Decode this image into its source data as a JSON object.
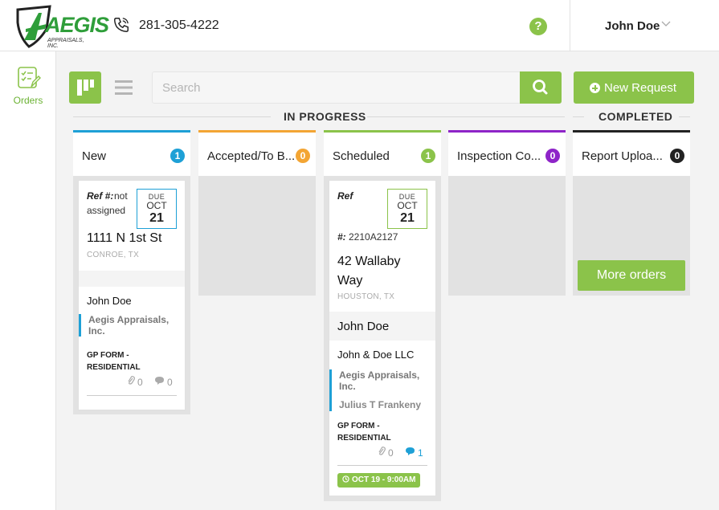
{
  "brand": {
    "name": "AEGIS",
    "sub": "APPRAISALS, INC."
  },
  "header": {
    "phone": "281-305-4222",
    "user_name": "John Doe"
  },
  "sidebar": {
    "items": [
      {
        "label": "Orders"
      }
    ]
  },
  "toolbar": {
    "search_placeholder": "Search",
    "new_request_label": "New Request"
  },
  "groups": {
    "in_progress": "IN PROGRESS",
    "completed": "COMPLETED"
  },
  "colors": {
    "accent": "#8bc34a",
    "blue": "#1ea0d6",
    "orange": "#f3a534",
    "green": "#8bc34a",
    "purple": "#8e24c8",
    "dark": "#222222"
  },
  "columns": [
    {
      "title": "New",
      "count": "1"
    },
    {
      "title": "Accepted/To B...",
      "count": "0"
    },
    {
      "title": "Scheduled",
      "count": "1"
    },
    {
      "title": "Inspection Co...",
      "count": "0"
    },
    {
      "title": "Report Uploa...",
      "count": "0"
    }
  ],
  "cards": [
    {
      "ref_label": "Ref #:",
      "ref_value_1": "not",
      "ref_value_2": "assigned",
      "due_label": "DUE",
      "due_month": "OCT",
      "due_day": "21",
      "address": "1111 N 1st St",
      "city": "CONROE, TX",
      "person": "John Doe",
      "company_1": "Aegis Appraisals,",
      "company_2": "Inc.",
      "form_1": "GP FORM -",
      "form_2": "RESIDENTIAL",
      "attachments": "0",
      "comments": "0"
    },
    {
      "ref_label_1": "Ref",
      "ref_label_2": "#:",
      "ref_value": "2210A2127",
      "due_label": "DUE",
      "due_month": "OCT",
      "due_day": "21",
      "address_1": "42 Wallaby",
      "address_2": "Way",
      "city": "HOUSTON, TX",
      "person": "John Doe",
      "client": "John & Doe LLC",
      "company_1": "Aegis Appraisals,",
      "company_2": "Inc.",
      "appraiser": "Julius T Frankeny",
      "form_1": "GP FORM -",
      "form_2": "RESIDENTIAL",
      "attachments": "0",
      "comments": "1",
      "appointment": "OCT 19 - 9:00AM"
    }
  ],
  "more_orders_label": "More orders"
}
